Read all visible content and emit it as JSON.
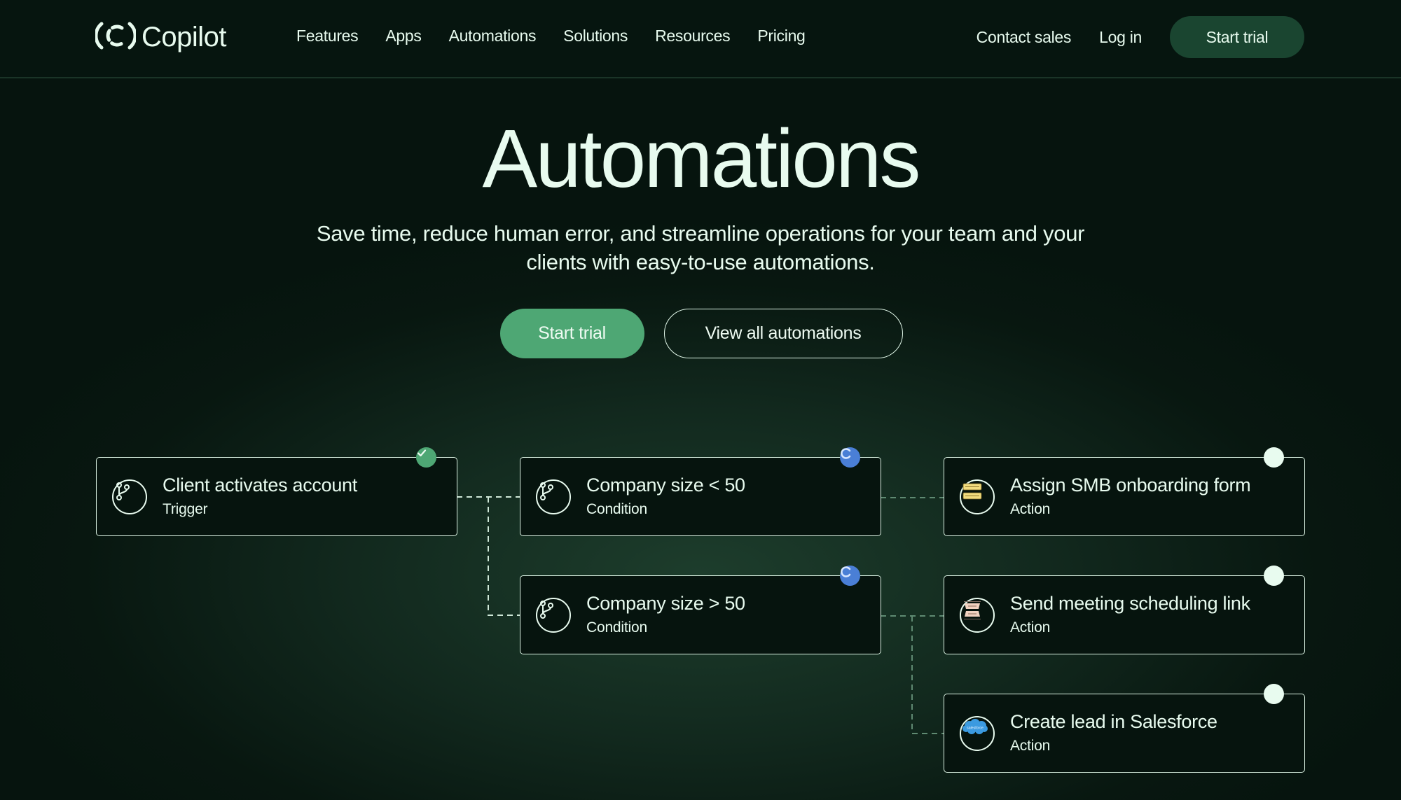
{
  "brand": {
    "name": "Copilot"
  },
  "nav": {
    "items": [
      "Features",
      "Apps",
      "Automations",
      "Solutions",
      "Resources",
      "Pricing"
    ],
    "contact_sales": "Contact sales",
    "log_in": "Log in",
    "start_trial": "Start trial"
  },
  "hero": {
    "title": "Automations",
    "subtitle_line1": "Save time, reduce human error, and streamline operations for your team and your",
    "subtitle_line2": "clients with easy-to-use automations.",
    "primary_cta": "Start trial",
    "secondary_cta": "View all automations"
  },
  "colors": {
    "accent_green": "#4ea774",
    "pending_blue": "#4a7fd6",
    "text": "#e8fbef"
  },
  "workflow": {
    "trigger": {
      "title": "Client activates account",
      "type": "Trigger",
      "icon": "branch-icon",
      "status": "complete"
    },
    "conditions": [
      {
        "title": "Company size < 50",
        "type": "Condition",
        "icon": "branch-icon",
        "status": "in-progress"
      },
      {
        "title": "Company size > 50",
        "type": "Condition",
        "icon": "branch-icon",
        "status": "in-progress"
      }
    ],
    "actions": [
      {
        "title": "Assign SMB onboarding form",
        "type": "Action",
        "icon": "form-icon",
        "status": "pending"
      },
      {
        "title": "Send meeting scheduling link",
        "type": "Action",
        "icon": "calendar-link-icon",
        "status": "pending"
      },
      {
        "title": "Create lead in Salesforce",
        "type": "Action",
        "icon": "salesforce-icon",
        "status": "pending"
      }
    ],
    "salesforce_logo_text": "salesforce"
  }
}
